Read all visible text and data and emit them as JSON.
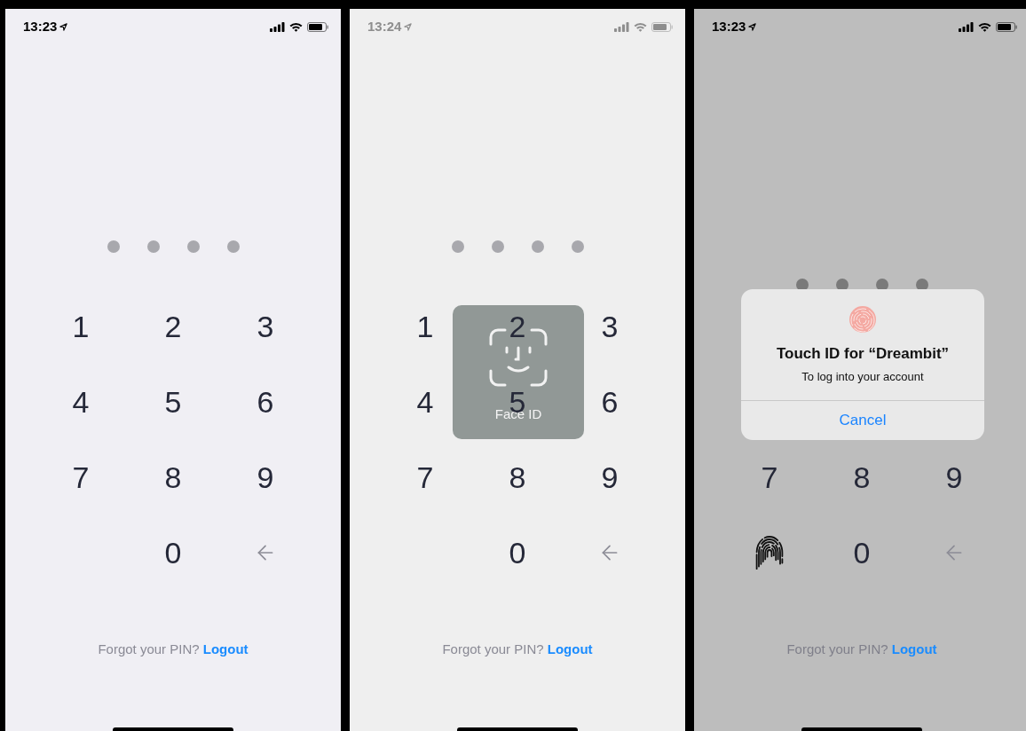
{
  "screens": [
    {
      "status_bar": {
        "time": "13:23"
      },
      "dimmed": false,
      "keypad": [
        [
          {
            "kind": "digit",
            "label": "1"
          },
          {
            "kind": "digit",
            "label": "2"
          },
          {
            "kind": "digit",
            "label": "3"
          }
        ],
        [
          {
            "kind": "digit",
            "label": "4"
          },
          {
            "kind": "digit",
            "label": "5"
          },
          {
            "kind": "digit",
            "label": "6"
          }
        ],
        [
          {
            "kind": "digit",
            "label": "7"
          },
          {
            "kind": "digit",
            "label": "8"
          },
          {
            "kind": "digit",
            "label": "9"
          }
        ],
        [
          {
            "kind": "empty"
          },
          {
            "kind": "digit",
            "label": "0"
          },
          {
            "kind": "backspace"
          }
        ]
      ],
      "footer": {
        "text": "Forgot your PIN?",
        "link": "Logout"
      }
    },
    {
      "status_bar": {
        "time": "13:24"
      },
      "dimmed": false,
      "keypad": [
        [
          {
            "kind": "digit",
            "label": "1"
          },
          {
            "kind": "digit",
            "label": "2"
          },
          {
            "kind": "digit",
            "label": "3"
          }
        ],
        [
          {
            "kind": "digit",
            "label": "4"
          },
          {
            "kind": "digit",
            "label": "5"
          },
          {
            "kind": "digit",
            "label": "6"
          }
        ],
        [
          {
            "kind": "digit",
            "label": "7"
          },
          {
            "kind": "digit",
            "label": "8"
          },
          {
            "kind": "digit",
            "label": "9"
          }
        ],
        [
          {
            "kind": "empty"
          },
          {
            "kind": "digit",
            "label": "0"
          },
          {
            "kind": "backspace"
          }
        ]
      ],
      "overlay": {
        "kind": "face_id",
        "label": "Face ID"
      },
      "footer": {
        "text": "Forgot your PIN?",
        "link": "Logout"
      }
    },
    {
      "status_bar": {
        "time": "13:23"
      },
      "dimmed": true,
      "keypad": [
        [
          {
            "kind": "digit",
            "label": "7"
          },
          {
            "kind": "digit",
            "label": "8"
          },
          {
            "kind": "digit",
            "label": "9"
          }
        ],
        [
          {
            "kind": "fingerprint"
          },
          {
            "kind": "digit",
            "label": "0"
          },
          {
            "kind": "backspace"
          }
        ]
      ],
      "overlay": {
        "kind": "touch_id_alert",
        "title": "Touch ID for “Dreambit”",
        "message": "To log into your account",
        "button": "Cancel"
      },
      "footer": {
        "text": "Forgot your PIN?",
        "link": "Logout"
      }
    }
  ]
}
